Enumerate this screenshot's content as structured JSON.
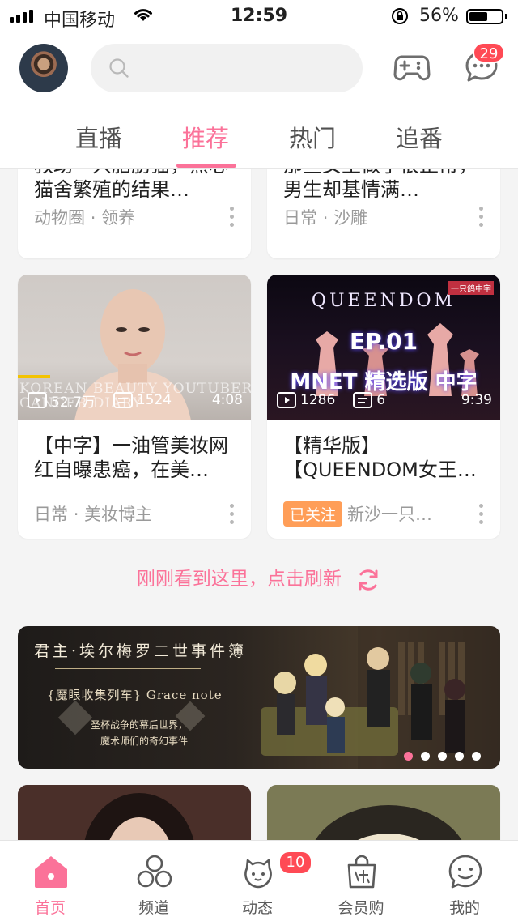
{
  "status_bar": {
    "carrier": "中国移动",
    "time": "12:59",
    "battery_percent": "56%"
  },
  "header": {
    "search_placeholder": "",
    "message_badge": "29",
    "tabs": [
      {
        "label": "直播"
      },
      {
        "label": "推荐",
        "active": true
      },
      {
        "label": "热门"
      },
      {
        "label": "追番"
      }
    ]
  },
  "feed": {
    "top_cards": [
      {
        "title": "救助一只脂肪猫，黑心猫舍繁殖的结果…",
        "tag1": "动物圈",
        "tag2": "领养"
      },
      {
        "title": "那些女生做了很正常，男生却基情满…",
        "tag1": "日常",
        "tag2": "沙雕"
      }
    ],
    "video_cards": [
      {
        "views": "52.7万",
        "danmaku": "1524",
        "duration": "4:08",
        "thumb_text": "KOREAN BEAUTY YOUTUBER\nCANCER DIARY",
        "title": "【中字】一油管美妆网红自曝患癌，在美…",
        "tag1": "日常",
        "tag2": "美妆博主"
      },
      {
        "views": "1286",
        "danmaku": "6",
        "duration": "9:39",
        "thumb_brand": "QUEENDOM",
        "thumb_ep": "EP.01",
        "thumb_caption": "MNET 精选版 中字",
        "thumb_corner": "一只鸽中字",
        "title": "【精华版】【QUEENDOM女王…",
        "followed_label": "已关注",
        "uploader": "新沙一只…"
      }
    ],
    "refresh_text": "刚刚看到这里，点击刷新",
    "banner": {
      "title": "君主·埃尔梅罗二世事件簿",
      "subtitle": "{魔眼收集列车} Grace note",
      "desc_line1": "圣杯战争的幕后世界，",
      "desc_line2": "魔术师们的奇幻事件",
      "active_dot": 0,
      "dot_count": 5
    }
  },
  "bottom_nav": {
    "items": [
      {
        "label": "首页",
        "icon": "home-icon",
        "active": true
      },
      {
        "label": "频道",
        "icon": "channel-icon"
      },
      {
        "label": "动态",
        "icon": "dynamic-icon",
        "badge": "10"
      },
      {
        "label": "会员购",
        "icon": "shopping-bag-icon"
      },
      {
        "label": "我的",
        "icon": "mine-icon"
      }
    ]
  },
  "colors": {
    "accent": "#fb7299",
    "badge": "#ff4a55",
    "followed": "#ff9e58"
  }
}
